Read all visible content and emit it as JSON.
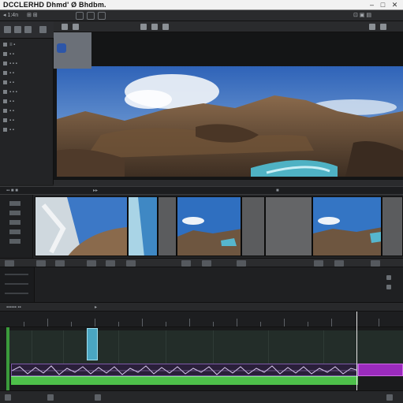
{
  "window": {
    "title": "DCCLERHD Dhmd' Ø Bhdbm.",
    "controls": [
      "–",
      "□",
      "✕"
    ]
  },
  "menubar": {
    "items": [
      "◂ 1:4n",
      "⊞ ⊞",
      "⊡ ▣ ▤"
    ]
  },
  "left_panel": {
    "rows": [
      "≡ ▪",
      "▪ ▪",
      "▪ ▪ ▪",
      "▪ ▪",
      "▪ ▪",
      "▪ ▪ ▪",
      "▪ ▪",
      "▪ ▪",
      "▪ ▪",
      "▪ ▪"
    ]
  },
  "viewer": {
    "toolbar_text": [
      "▸",
      "▶",
      "⊞ ⊞ ⊞"
    ]
  },
  "midbar": {
    "labels": [
      "▪▪ ■ ■",
      "▸▸",
      "■"
    ]
  },
  "timeline_header": {
    "label": "▪▪▪▪▪▪ ▪▪",
    "time": "▸"
  },
  "colors": {
    "accent_purple": "#9b2bbd",
    "audio_green": "#4ec04a",
    "clip_cyan": "#4aa6c2",
    "playhead": "#e6e6e6"
  },
  "icons": [
    "minimize-icon",
    "maximize-icon",
    "close-icon",
    "play-icon",
    "grid-icon",
    "folder-icon"
  ]
}
